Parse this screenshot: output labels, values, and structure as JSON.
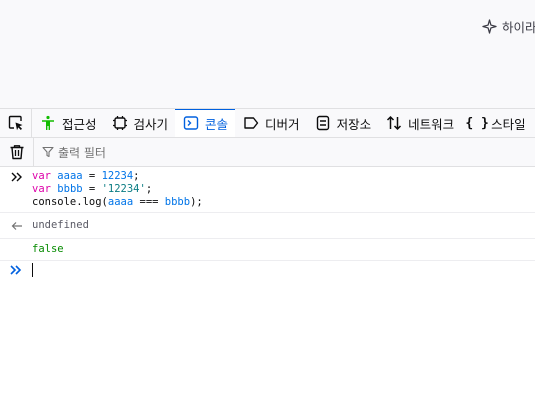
{
  "top": {
    "ai_label": "하이라"
  },
  "tabs": [
    {
      "label": "접근성",
      "icon": "accessibility-icon"
    },
    {
      "label": "검사기",
      "icon": "inspector-icon"
    },
    {
      "label": "콘솔",
      "icon": "console-icon"
    },
    {
      "label": "디버거",
      "icon": "debugger-icon"
    },
    {
      "label": "저장소",
      "icon": "storage-icon"
    },
    {
      "label": "네트워크",
      "icon": "network-icon"
    },
    {
      "label": "스타일",
      "icon": "style-editor-icon"
    }
  ],
  "toolbar": {
    "filter_placeholder": "출력 필터"
  },
  "console": {
    "input": {
      "line1": {
        "kw": "var",
        "name": "aaaa",
        "op": " = ",
        "val": "12234",
        "end": ";"
      },
      "line2": {
        "kw": "var",
        "name": "bbbb",
        "op": " = ",
        "val": "'12234'",
        "end": ";"
      },
      "line3": {
        "obj": "console",
        "fn": ".log(",
        "arg1": "aaaa",
        "op": " === ",
        "arg2": "bbbb",
        "end": ");"
      }
    },
    "result1": "undefined",
    "result2": "false"
  },
  "colors": {
    "accent": "#0060df",
    "keyword": "#dd00a9",
    "variable": "#0074e8",
    "string": "#0a7c83",
    "boolean": "#058b00"
  }
}
